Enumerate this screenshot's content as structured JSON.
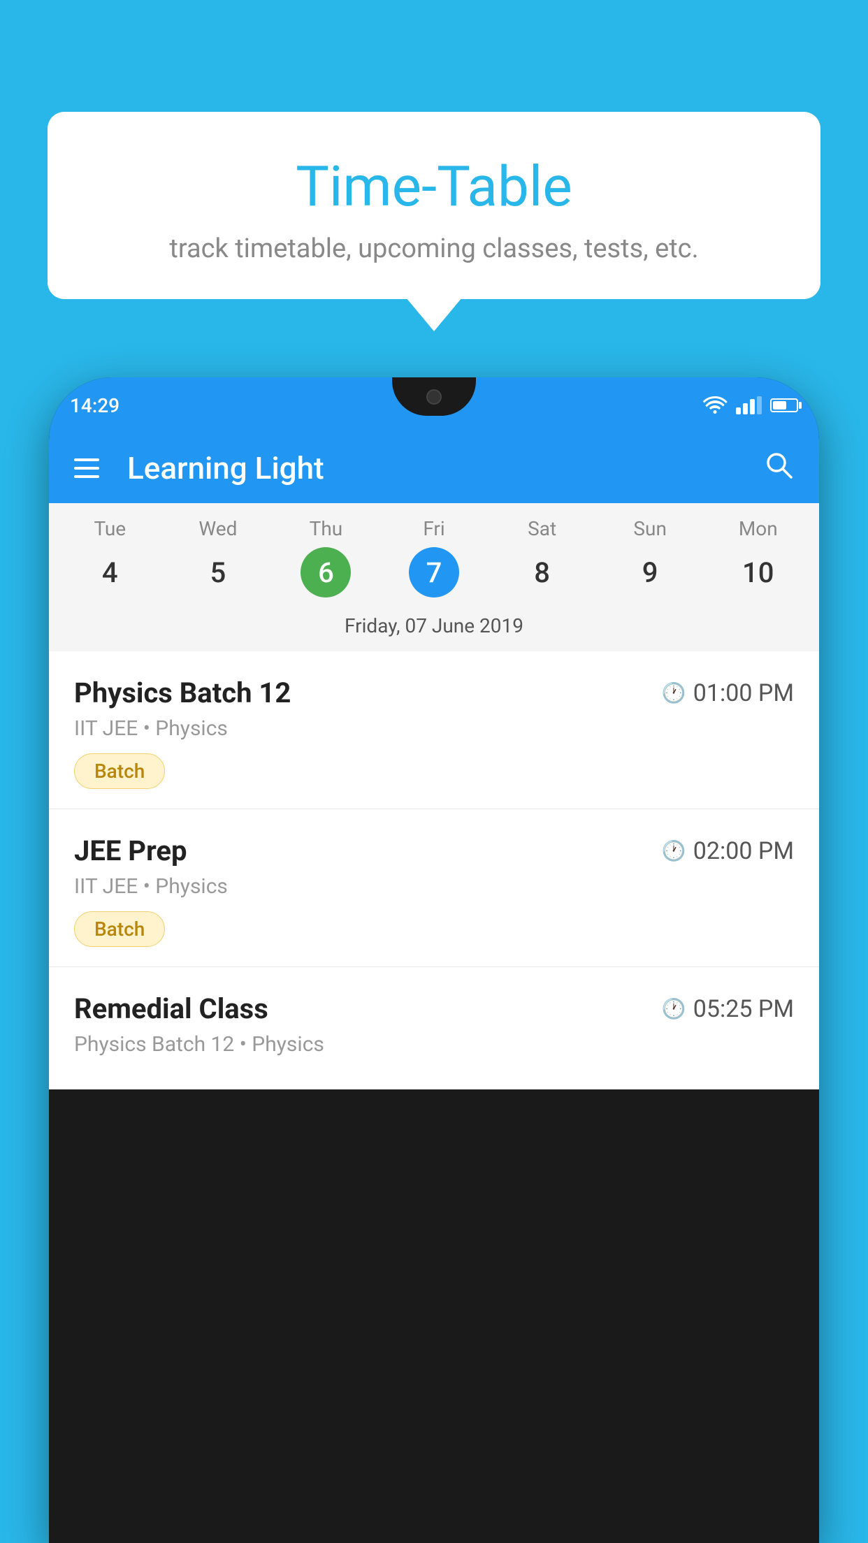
{
  "background_color": "#29b6e8",
  "tooltip": {
    "title": "Time-Table",
    "subtitle": "track timetable, upcoming classes, tests, etc."
  },
  "phone": {
    "status_bar": {
      "time": "14:29"
    },
    "app_header": {
      "title": "Learning Light"
    },
    "calendar": {
      "days": [
        {
          "name": "Tue",
          "number": "4",
          "state": "normal"
        },
        {
          "name": "Wed",
          "number": "5",
          "state": "normal"
        },
        {
          "name": "Thu",
          "number": "6",
          "state": "today"
        },
        {
          "name": "Fri",
          "number": "7",
          "state": "selected"
        },
        {
          "name": "Sat",
          "number": "8",
          "state": "normal"
        },
        {
          "name": "Sun",
          "number": "9",
          "state": "normal"
        },
        {
          "name": "Mon",
          "number": "10",
          "state": "normal"
        }
      ],
      "selected_date_label": "Friday, 07 June 2019"
    },
    "classes": [
      {
        "name": "Physics Batch 12",
        "time": "01:00 PM",
        "subtitle": "IIT JEE • Physics",
        "badge": "Batch"
      },
      {
        "name": "JEE Prep",
        "time": "02:00 PM",
        "subtitle": "IIT JEE • Physics",
        "badge": "Batch"
      },
      {
        "name": "Remedial Class",
        "time": "05:25 PM",
        "subtitle": "Physics Batch 12 • Physics",
        "badge": null
      }
    ]
  }
}
